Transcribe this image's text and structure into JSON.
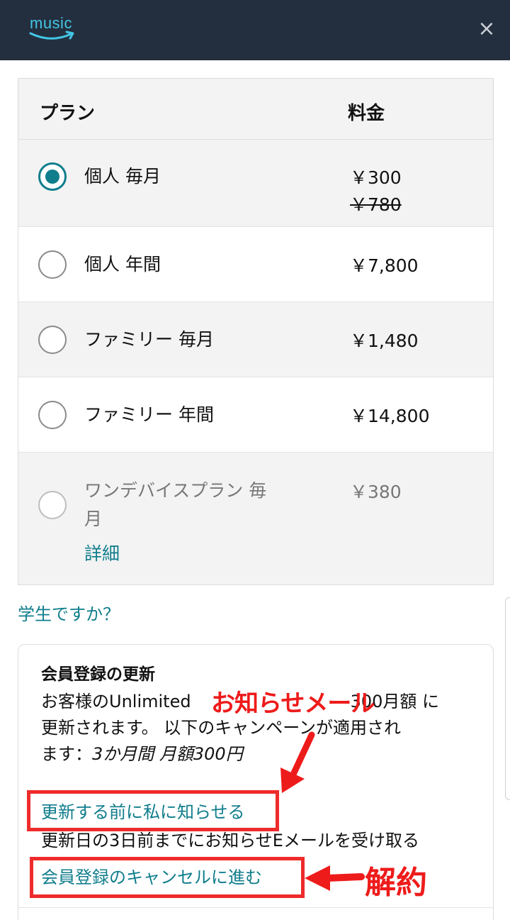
{
  "header": {
    "logo_text": "music",
    "close_label": "×"
  },
  "table": {
    "col_plan": "プラン",
    "col_price": "料金",
    "rows": [
      {
        "name": "個人 毎月",
        "price": "￥300",
        "old_price": "￥780",
        "selected": true
      },
      {
        "name": "個人 年間",
        "price": "￥7,800",
        "selected": false
      },
      {
        "name": "ファミリー 毎月",
        "price": "￥1,480",
        "selected": false
      },
      {
        "name": "ファミリー 年間",
        "price": "￥14,800",
        "selected": false
      },
      {
        "name_line1": "ワンデバイスプラン 毎",
        "name_line2": "月",
        "price": "￥380",
        "detail_link": "詳細",
        "selected": false,
        "disabled": true
      }
    ]
  },
  "student_link": "学生ですか？",
  "renewal": {
    "title": "会員登録の更新",
    "body_line1": "お客様のUnlimited",
    "body_line1_end": "300月額 に",
    "body_line2": "更新されます。 以下のキャンペーンが適用され",
    "body_line3_prefix": "ます：",
    "body_line3_campaign": "3か月間 月額300円",
    "notify_link": "更新する前に私に知らせる",
    "notify_desc": "更新日の3日前までにお知らせEメールを受け取る",
    "cancel_link": "会員登録のキャンセルに進む"
  },
  "annotations": {
    "mail_callout": "お知らせメール",
    "cancel_callout": "解約",
    "color": "#ee1b1b"
  },
  "colors": {
    "topbar": "#232f3e",
    "accent": "#0f7d8c",
    "logo": "#43c6e6"
  }
}
